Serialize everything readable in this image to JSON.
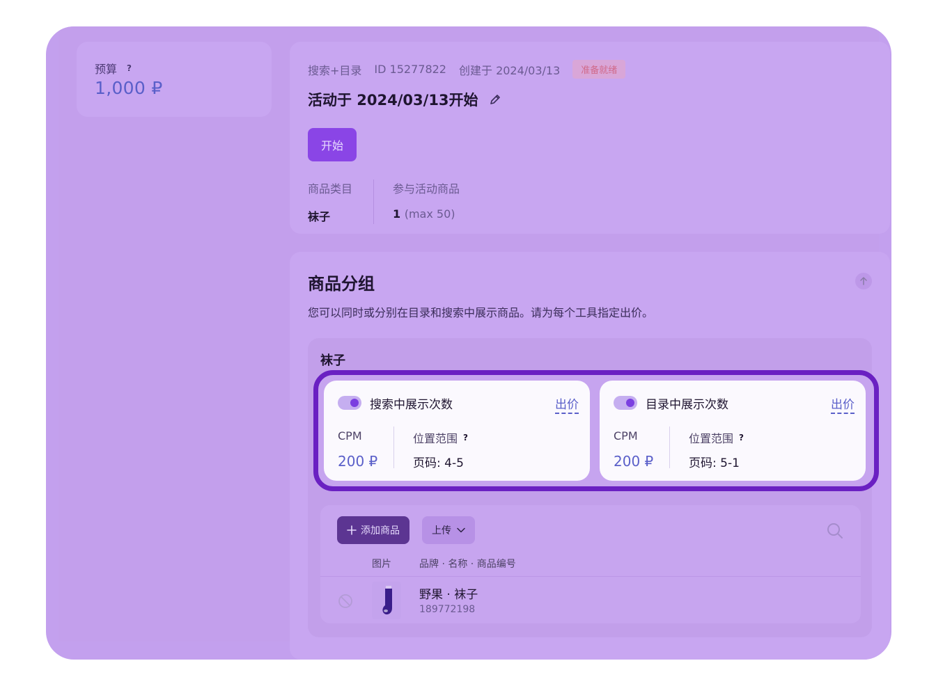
{
  "budget": {
    "label": "预算",
    "help": "?",
    "value": "1,000 ₽"
  },
  "campaign": {
    "type": "搜索+目录",
    "id": "ID 15277822",
    "created": "创建于 2024/03/13",
    "status": "准备就绪",
    "title": "活动于 2024/03/13开始",
    "start_button": "开始",
    "category_label": "商品类目",
    "category_value": "袜子",
    "products_label": "参与活动商品",
    "products_count": "1",
    "products_max": "(max 50)"
  },
  "groups": {
    "title": "商品分组",
    "description": "您可以同时或分别在目录和搜索中展示商品。请为每个工具指定出价。",
    "group_name": "袜子",
    "tools": [
      {
        "title": "搜索中展示次数",
        "bid_link": "出价",
        "cpm_label": "CPM",
        "cpm_value": "200 ₽",
        "position_label": "位置范围",
        "position_help": "?",
        "position_value": "页码: 4-5",
        "enabled": true
      },
      {
        "title": "目录中展示次数",
        "bid_link": "出价",
        "cpm_label": "CPM",
        "cpm_value": "200 ₽",
        "position_label": "位置范围",
        "position_help": "?",
        "position_value": "页码: 5-1",
        "enabled": true
      }
    ],
    "add_product_button": "添加商品",
    "upload_button": "上传",
    "columns": {
      "image": "图片",
      "name": "品牌 · 名称 · 商品编号"
    },
    "products": [
      {
        "name": "野果 · 袜子",
        "sku": "189772198"
      }
    ]
  },
  "colors": {
    "accent": "#8a45e6",
    "highlight_border": "#6a20c2",
    "link": "#5a5fc9",
    "status_text": "#d06a8a"
  },
  "icons": {
    "edit": "pencil-icon",
    "collapse": "arrow-up-icon",
    "add": "plus-icon",
    "dropdown": "chevron-down-icon",
    "search": "search-icon",
    "disabled": "block-icon"
  }
}
